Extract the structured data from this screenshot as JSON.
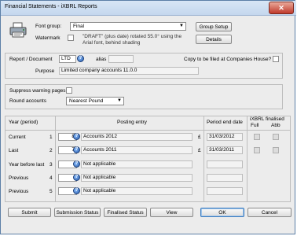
{
  "window": {
    "title": "Financial Statements - iXBRL Reports",
    "close_glyph": "✕"
  },
  "top": {
    "font_group_label": "Font group:",
    "font_group_value": "Final",
    "group_setup_label": "Group Setup",
    "watermark_label": "Watermark",
    "watermark_text": "\"DRAFT\" (plus date) rotated 55.0° using the Arial font, behind shading",
    "details_label": "Details"
  },
  "report": {
    "report_label": "Report / Document",
    "report_value": "LTD",
    "alias_label": "alias",
    "alias_value": "",
    "copy_label": "Copy to be filed at Companies House?",
    "purpose_label": "Purpose",
    "purpose_value": "Limited company accounts 11.0.0"
  },
  "options": {
    "suppress_label": "Suppress warning pages",
    "round_label": "Round accounts",
    "round_value": "Nearest Pound"
  },
  "table": {
    "headers": {
      "year": "Year (period)",
      "posting": "Posting entry",
      "period_end": "Period end date",
      "ixbrl": "iXBRL",
      "full": "Full",
      "finalised": "finalised",
      "abb": "Abb"
    },
    "rows": [
      {
        "period": "Current",
        "num": "1",
        "code": "8",
        "entry": "Accounts 2012",
        "currency": "£",
        "date": "31/03/2012"
      },
      {
        "period": "Last",
        "num": "2",
        "code": "7",
        "entry": "Accounts 2011",
        "currency": "£",
        "date": "31/03/2011"
      },
      {
        "period": "Year before last",
        "num": "3",
        "code": "",
        "entry": "Not applicable",
        "currency": "",
        "date": ""
      },
      {
        "period": "Previous",
        "num": "4",
        "code": "",
        "entry": "Not applicable",
        "currency": "",
        "date": ""
      },
      {
        "period": "Previous",
        "num": "5",
        "code": "",
        "entry": "Not applicable",
        "currency": "",
        "date": ""
      }
    ]
  },
  "buttons": {
    "submit": "Submit",
    "submission_status": "Submission Status",
    "finalised_status": "Finalised Status",
    "view": "View",
    "ok": "OK",
    "cancel": "Cancel"
  },
  "icons": {
    "printer": "printer-icon",
    "lookup": "lookup-icon"
  }
}
